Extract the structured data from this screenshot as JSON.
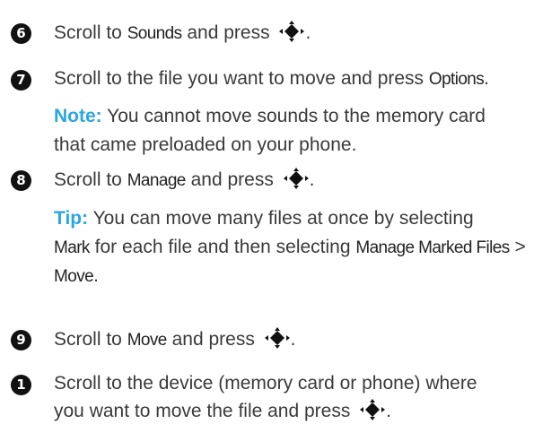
{
  "steps": [
    {
      "num": "6",
      "pre": "Scroll to ",
      "kw": "Sounds",
      "post": " and press "
    },
    {
      "num": "7",
      "pre": "Scroll to the file you want to move and press ",
      "kw": "Options",
      "post": "."
    },
    {
      "num": "8",
      "pre": "Scroll to ",
      "kw": "Manage",
      "post": " and press "
    },
    {
      "num": "9",
      "pre": "Scroll to ",
      "kw": "Move",
      "post": " and press "
    },
    {
      "num": "1",
      "line1": " Scroll to the device (memory card or phone) where",
      "line2": "you want to move the file and press "
    }
  ],
  "note": {
    "label": "Note:",
    "line1": " You cannot move sounds to the memory card",
    "line2": "that came preloaded on your phone."
  },
  "tip": {
    "label": "Tip:",
    "line1": " You can move many files at once by selecting",
    "line2_kw1": "Mark",
    "line2_mid": " for each file and then selecting ",
    "line2_kw2": "Manage Marked Files",
    "line2_post": " >",
    "line3_kw": "Move",
    "line3_post": "."
  },
  "nav_key_icon": "navigation-key-center-select-icon",
  "colors": {
    "label": "#2aa6e0",
    "text": "#3a3a3a",
    "badge": "#111111"
  }
}
